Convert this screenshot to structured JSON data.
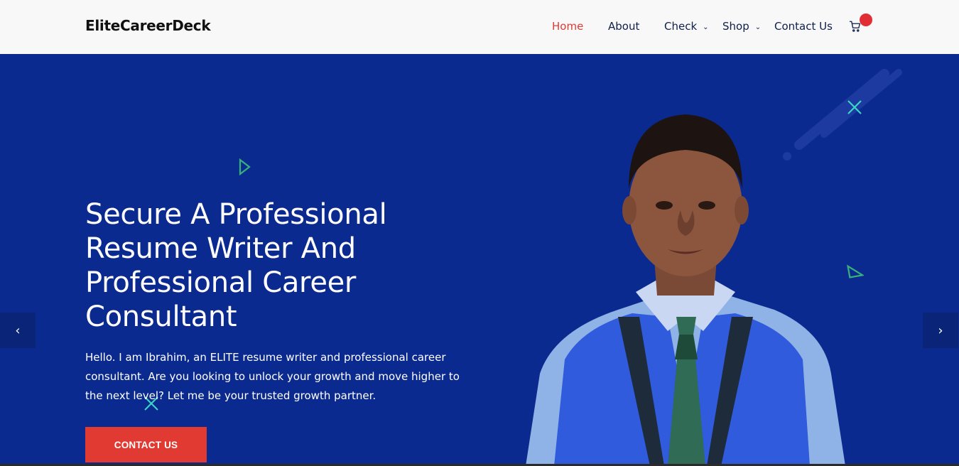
{
  "header": {
    "logo": "EliteCareerDeck",
    "nav": [
      {
        "label": "Home"
      },
      {
        "label": "About"
      },
      {
        "label": "Check"
      },
      {
        "label": "Shop"
      },
      {
        "label": "Contact Us"
      }
    ],
    "cart_icon": "cart-icon"
  },
  "hero": {
    "title": "Secure A Professional Resume Writer And Professional Career Consultant",
    "text": "Hello. I am Ibrahim, an ELITE resume writer and professional career consultant. Are you looking to unlock your growth and move higher to the next level? Let me be your trusted growth partner.",
    "cta": "CONTACT US",
    "prev_icon": "chevron-left-icon",
    "next_icon": "chevron-right-icon"
  },
  "colors": {
    "hero_bg": "#0b2a8f",
    "accent": "#e03a33",
    "nav_text": "#0f1f4b",
    "deco_teal": "#3ad6c6",
    "deco_green": "#37b17a"
  }
}
